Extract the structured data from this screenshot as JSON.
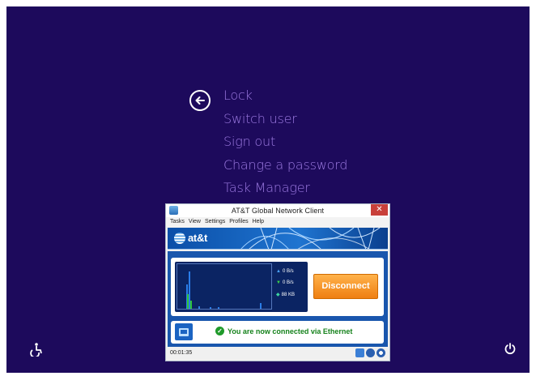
{
  "menu": {
    "items": [
      "Lock",
      "Switch user",
      "Sign out",
      "Change a password",
      "Task Manager"
    ]
  },
  "icons": {
    "back": "back-arrow-icon",
    "accessibility": "ease-of-access-icon",
    "power": "power-icon"
  },
  "colors": {
    "background": "#1d0a5c",
    "menu_text": "#9b79e0",
    "brand_blue": "#1956ad",
    "disconnect": "#ef7f12",
    "connected_green": "#15821b"
  },
  "client": {
    "title": "AT&T Global Network Client",
    "close_label": "✕",
    "menubar": [
      "Tasks",
      "View",
      "Settings",
      "Profiles",
      "Help"
    ],
    "brand": "at&t",
    "stats": {
      "upload": "0 B/s",
      "download": "0 B/s",
      "total": "88 KB"
    },
    "disconnect_label": "Disconnect",
    "status_message": "You are now connected via Ethernet",
    "timer": "00:01:35"
  }
}
